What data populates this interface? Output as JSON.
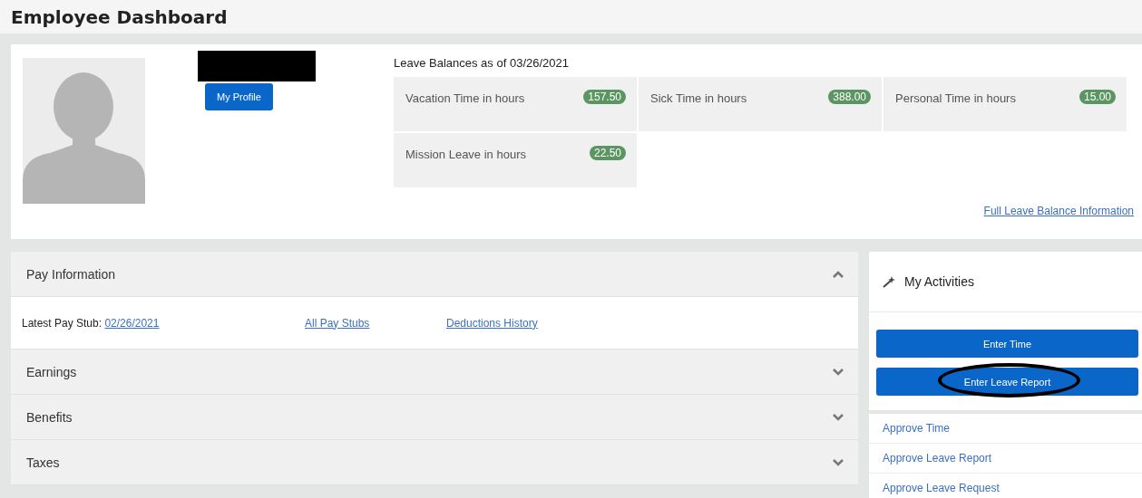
{
  "page_title": "Employee Dashboard",
  "profile": {
    "redacted": true,
    "button": "My Profile"
  },
  "leave": {
    "title": "Leave Balances as of 03/26/2021",
    "link": "Full Leave Balance Information",
    "balances": [
      {
        "label": "Vacation Time in hours",
        "value": "157.50"
      },
      {
        "label": "Sick Time in hours",
        "value": "388.00"
      },
      {
        "label": "Personal Time in hours",
        "value": "15.00"
      },
      {
        "label": "Mission Leave in hours",
        "value": "22.50"
      }
    ]
  },
  "sections": [
    {
      "title": "Pay Information",
      "expanded": true,
      "content": {
        "label": "Latest Pay Stub:",
        "date_link": "02/26/2021",
        "links": [
          "All Pay Stubs",
          "Deductions History"
        ]
      }
    },
    {
      "title": "Earnings",
      "expanded": false
    },
    {
      "title": "Benefits",
      "expanded": false
    },
    {
      "title": "Taxes",
      "expanded": false
    }
  ],
  "activities": {
    "title": "My Activities",
    "buttons": [
      {
        "label": "Enter Time",
        "circled": false
      },
      {
        "label": "Enter Leave Report",
        "circled": true
      }
    ],
    "links": [
      "Approve Time",
      "Approve Leave Report",
      "Approve Leave Request"
    ]
  }
}
